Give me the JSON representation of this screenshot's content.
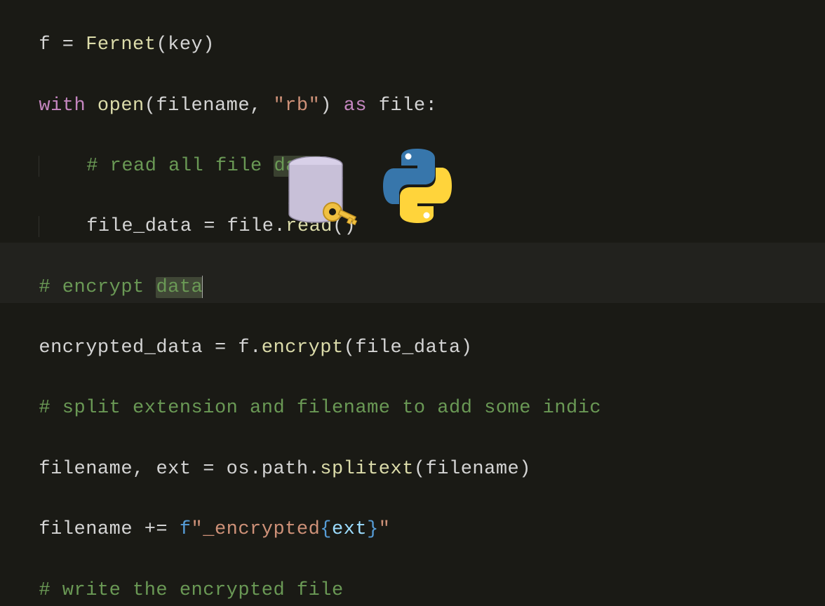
{
  "code": {
    "line1": {
      "var": "f",
      "eq": " = ",
      "fn": "Fernet",
      "open": "(",
      "arg": "key",
      "close": ")"
    },
    "line2": {
      "kw_with": "with",
      "sp1": " ",
      "fn_open": "open",
      "open": "(",
      "arg1": "filename",
      "comma": ", ",
      "str": "\"rb\"",
      "close": ")",
      "sp2": " ",
      "kw_as": "as",
      "sp3": " ",
      "var_file": "file",
      "colon": ":"
    },
    "line3": {
      "indent": "    ",
      "comment_pre": "# read all file ",
      "comment_hl": "data"
    },
    "line4": {
      "indent": "    ",
      "var": "file_data",
      "eq": " = ",
      "obj": "file",
      "dot": ".",
      "method": "read",
      "parens": "()"
    },
    "line5": {
      "comment_pre": "# encrypt ",
      "comment_hl": "data"
    },
    "line6": {
      "var": "encrypted_data",
      "eq": " = ",
      "obj": "f",
      "dot": ".",
      "method": "encrypt",
      "open": "(",
      "arg": "file_data",
      "close": ")"
    },
    "line7": {
      "comment": "# split extension and filename to add some indic"
    },
    "line8": {
      "var1": "filename",
      "comma": ", ",
      "var2": "ext",
      "eq": " = ",
      "mod1": "os",
      "dot1": ".",
      "mod2": "path",
      "dot2": ".",
      "fn": "splitext",
      "open": "(",
      "arg": "filename",
      "close": ")"
    },
    "line9": {
      "var": "filename",
      "op": " += ",
      "fprefix": "f",
      "str_open": "\"",
      "str_lit": "_encrypted",
      "brace_open": "{",
      "fvar": "ext",
      "brace_close": "}",
      "str_close": "\""
    },
    "line10": {
      "comment": "# write the encrypted file"
    }
  }
}
